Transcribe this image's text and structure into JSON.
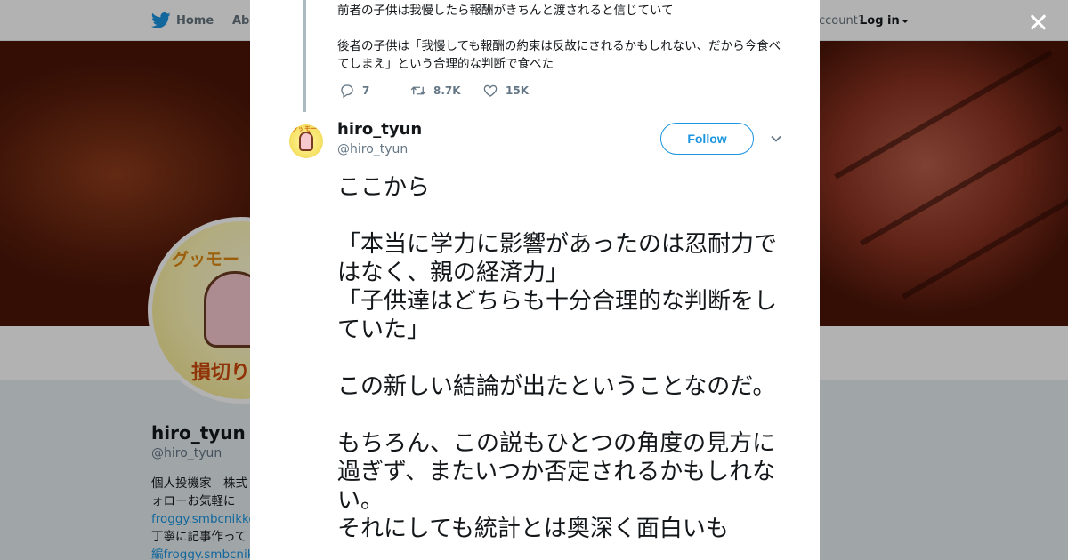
{
  "nav": {
    "home_label": "Home",
    "about_label": "Abo",
    "account_text": "ccount?",
    "login_label": "Log in"
  },
  "profile": {
    "avatar_text_top": "グッモー",
    "avatar_text_bottom": "損切り",
    "name": "hiro_tyun",
    "handle": "@hiro_tyun",
    "bio_lines": [
      "個人投機家　株式",
      "ォローお気軽に",
      "froggy.smbcnikko.",
      "丁寧に記事作って",
      "編froggy.smbcnikk"
    ]
  },
  "previous_tweet": {
    "lines": [
      "前者の子供は我慢したら報酬がきちんと渡されると信じていて",
      "",
      "後者の子供は「我慢しても報酬の約束は反故にされるかもしれない、だから今食べてしまえ」という合理的な判断で食べた"
    ],
    "reply_count": "7",
    "retweet_count": "8.7K",
    "like_count": "15K"
  },
  "tweet": {
    "author_name": "hiro_tyun",
    "author_handle": "@hiro_tyun",
    "avatar_text": "グッモー",
    "follow_label": "Follow",
    "text_lines": [
      "ここから",
      "",
      "「本当に学力に影響があったのは忍耐力ではなく、親の経済力」",
      "「子供達はどちらも十分合理的な判断をしていた」",
      "",
      "この新しい結論が出たということなのだ。",
      "",
      "もちろん、この説もひとつの角度の見方に過ぎず、またいつか否定されるかもしれない。",
      "それにしても統計とは奥深く面白いも"
    ]
  },
  "icons": {
    "brand": "twitter-bird-icon",
    "close": "close-icon",
    "reply": "reply-icon",
    "retweet": "retweet-icon",
    "like": "heart-icon",
    "menu": "chevron-down-icon"
  },
  "colors": {
    "brand_blue": "#1b95e0",
    "text": "#14171a",
    "muted": "#657786",
    "thread_line": "#aab8c2",
    "overlay": "rgba(0,0,0,0.30)"
  }
}
